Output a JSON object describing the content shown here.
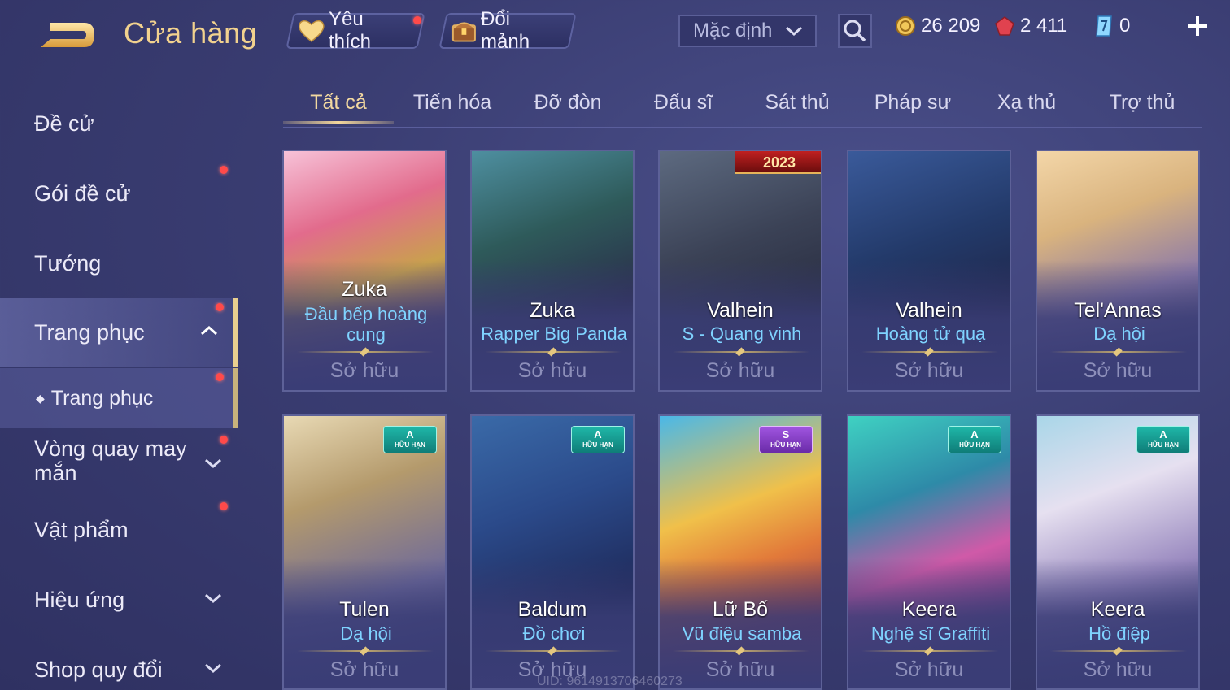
{
  "header": {
    "title": "Cửa hàng",
    "favorites_label": "Yêu thích",
    "exchange_label": "Đổi mảnh",
    "sort": {
      "selected": "Mặc định"
    },
    "currencies": [
      {
        "icon": "gold-coin-icon",
        "value": "26 209"
      },
      {
        "icon": "red-gem-icon",
        "value": "2 411"
      },
      {
        "icon": "blue-voucher-icon",
        "value": "0"
      }
    ]
  },
  "sidebar": {
    "items": [
      {
        "label": "Đề cử"
      },
      {
        "label": "Gói đề cử"
      },
      {
        "label": "Tướng"
      },
      {
        "label": "Trang phục"
      },
      {
        "label": "Trang phục"
      },
      {
        "label": "Vòng quay may mắn"
      },
      {
        "label": "Vật phẩm"
      },
      {
        "label": "Hiệu ứng"
      },
      {
        "label": "Shop quy đổi"
      }
    ]
  },
  "tabs": [
    "Tất cả",
    "Tiến hóa",
    "Đỡ đòn",
    "Đấu sĩ",
    "Sát thủ",
    "Pháp sư",
    "Xạ thủ",
    "Trợ thủ"
  ],
  "cards": [
    {
      "hero": "Zuka",
      "skin": "Đầu bếp hoàng cung",
      "status": "Sở hữu",
      "badge": "",
      "badge_label": "",
      "banner": ""
    },
    {
      "hero": "Zuka",
      "skin": "Rapper Big Panda",
      "status": "Sở hữu",
      "badge": "",
      "badge_label": "",
      "banner": ""
    },
    {
      "hero": "Valhein",
      "skin": "S - Quang vinh",
      "status": "Sở hữu",
      "badge": "",
      "badge_label": "",
      "banner": "2023"
    },
    {
      "hero": "Valhein",
      "skin": "Hoàng tử quạ",
      "status": "Sở hữu",
      "badge": "",
      "badge_label": "",
      "banner": ""
    },
    {
      "hero": "Tel'Annas",
      "skin": "Dạ hội",
      "status": "Sở hữu",
      "badge": "",
      "badge_label": "",
      "banner": ""
    },
    {
      "hero": "Tulen",
      "skin": "Dạ hội",
      "status": "Sở hữu",
      "badge": "A",
      "badge_label": "HỮU HẠN",
      "banner": ""
    },
    {
      "hero": "Baldum",
      "skin": "Đồ chơi",
      "status": "Sở hữu",
      "badge": "A",
      "badge_label": "HỮU HẠN",
      "banner": ""
    },
    {
      "hero": "Lữ Bố",
      "skin": "Vũ điệu samba",
      "status": "Sở hữu",
      "badge": "S",
      "badge_label": "HỮU HẠN",
      "banner": ""
    },
    {
      "hero": "Keera",
      "skin": "Nghệ sĩ Graffiti",
      "status": "Sở hữu",
      "badge": "A",
      "badge_label": "HỮU HẠN",
      "banner": ""
    },
    {
      "hero": "Keera",
      "skin": "Hồ điệp",
      "status": "Sở hữu",
      "badge": "A",
      "badge_label": "HỮU HẠN",
      "banner": ""
    }
  ],
  "uid": "UID: 96149137064602​73",
  "colors": {
    "accent_gold": "#f2d28e",
    "skin_name_blue": "#7fd3ff",
    "notification_red": "#ff4a4a",
    "badge_a": "#1fb7a8",
    "badge_s": "#a055e0"
  }
}
